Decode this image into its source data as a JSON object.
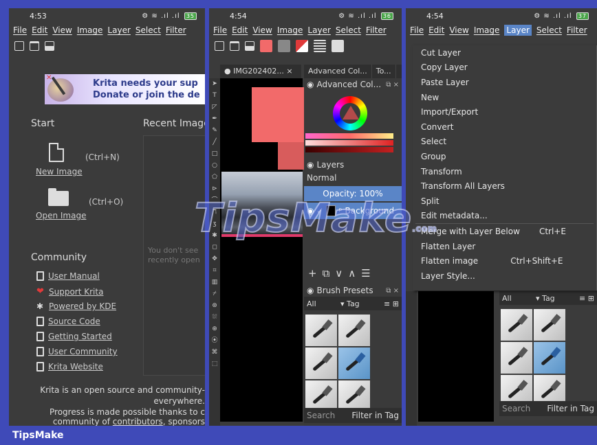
{
  "brand": "TipsMake",
  "watermark": "TipsMake",
  "watermark_suffix": ".com",
  "screens": [
    {
      "time": "4:53",
      "battery": "35",
      "menu": [
        "File",
        "Edit",
        "View",
        "Image",
        "Layer",
        "Select",
        "Filter"
      ],
      "banner": {
        "line1": "Krita needs your sup",
        "line2": "Donate or join the de"
      },
      "start_heading": "Start",
      "recent_heading": "Recent Image",
      "recent_empty": [
        "You don't see",
        "recently open"
      ],
      "new_image": {
        "label": "New Image",
        "shortcut": "(Ctrl+N)"
      },
      "open_image": {
        "label": "Open Image",
        "shortcut": "(Ctrl+O)"
      },
      "community_heading": "Community",
      "community_links": [
        "User Manual",
        "Support Krita",
        "Powered by KDE",
        "Source Code",
        "Getting Started",
        "User Community",
        "Krita Website"
      ],
      "footer": {
        "line1": "Krita is an open source and community-",
        "line2": "everywhere.",
        "line3": "Progress is made possible thanks to c",
        "line4_pre": "community of ",
        "line4_link": "contributors",
        "line4_post": ", sponsors"
      }
    },
    {
      "time": "4:54",
      "battery": "36",
      "menu": [
        "File",
        "Edit",
        "View",
        "Image",
        "Layer",
        "Select",
        "Filter"
      ],
      "canvas_tab": "IMG202402...",
      "dock_tabs": [
        "Advanced Col...",
        "To..."
      ],
      "color_title": "Advanced Col...",
      "layers_title": "Layers",
      "blend_mode": "Normal",
      "opacity": "Opacity:  100%",
      "layer_name": "Background",
      "brush_title": "Brush Presets",
      "brush_filter": "All",
      "brush_tag": "Tag",
      "search_placeholder": "Search",
      "filter_in_tag": "Filter in Tag"
    },
    {
      "time": "4:54",
      "battery": "37",
      "menu": [
        "File",
        "Edit",
        "View",
        "Image",
        "Layer",
        "Select",
        "Filter"
      ],
      "active_menu": "Layer",
      "layer_menu": [
        {
          "label": "Cut Layer",
          "shortcut": ""
        },
        {
          "label": "Copy Layer",
          "shortcut": ""
        },
        {
          "label": "Paste Layer",
          "shortcut": ""
        },
        {
          "label": "New",
          "shortcut": ""
        },
        {
          "label": "Import/Export",
          "shortcut": ""
        },
        {
          "label": "Convert",
          "shortcut": ""
        },
        {
          "label": "Select",
          "shortcut": ""
        },
        {
          "label": "Group",
          "shortcut": ""
        },
        {
          "label": "Transform",
          "shortcut": ""
        },
        {
          "label": "Transform All Layers",
          "shortcut": ""
        },
        {
          "label": "Split",
          "shortcut": ""
        },
        {
          "label": "Edit metadata...",
          "shortcut": ""
        },
        {
          "label": "Merge with Layer Below",
          "shortcut": "Ctrl+E"
        },
        {
          "label": "Flatten Layer",
          "shortcut": ""
        },
        {
          "label": "Flatten image",
          "shortcut": "Ctrl+Shift+E"
        },
        {
          "label": "Layer Style...",
          "shortcut": ""
        }
      ],
      "brush_filter": "All",
      "brush_tag": "Tag",
      "search_placeholder": "Search",
      "filter_in_tag": "Filter in Tag"
    }
  ]
}
